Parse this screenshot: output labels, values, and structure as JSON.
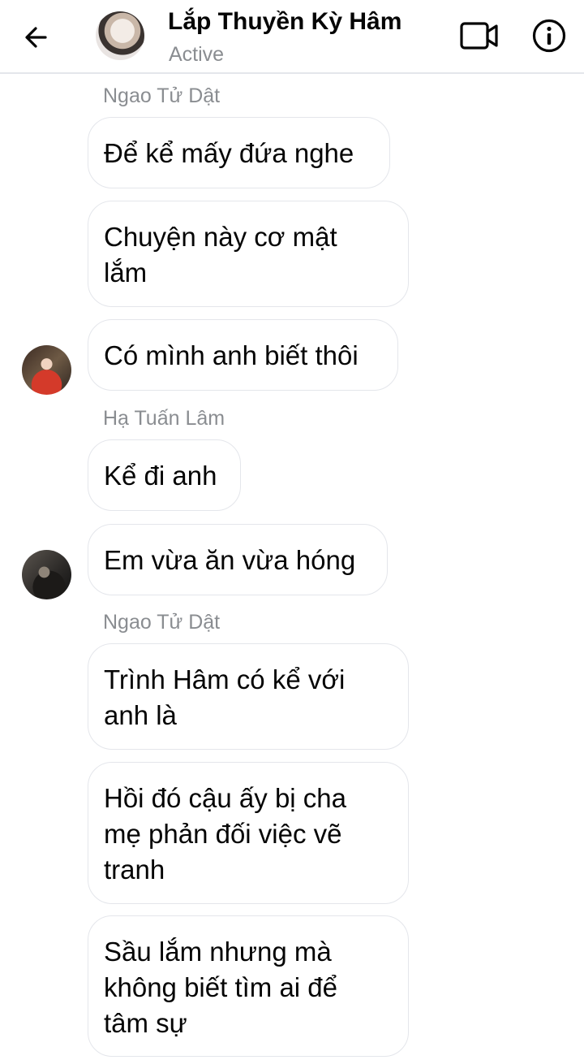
{
  "header": {
    "title": "Lắp Thuyền Kỳ Hâm",
    "status": "Active"
  },
  "messages": [
    {
      "sender": "Ngao Tử Dật",
      "text": "Để kể mấy đứa nghe"
    },
    {
      "text": "Chuyện này cơ mật\nlắm"
    },
    {
      "text": "Có mình anh biết thôi"
    },
    {
      "sender": "Hạ Tuấn Lâm",
      "text": "Kể đi anh"
    },
    {
      "text": "Em vừa ăn vừa hóng"
    },
    {
      "sender": "Ngao Tử Dật",
      "text": "Trình Hâm có kể với\nanh là"
    },
    {
      "text": "Hồi đó cậu ấy bị cha\nmẹ phản đối việc vẽ\ntranh"
    },
    {
      "text": "Sầu lắm nhưng mà\nkhông biết tìm ai để\ntâm sự"
    }
  ],
  "icons": {
    "back": "back-arrow-icon",
    "video": "video-camera-icon",
    "info": "info-icon"
  }
}
